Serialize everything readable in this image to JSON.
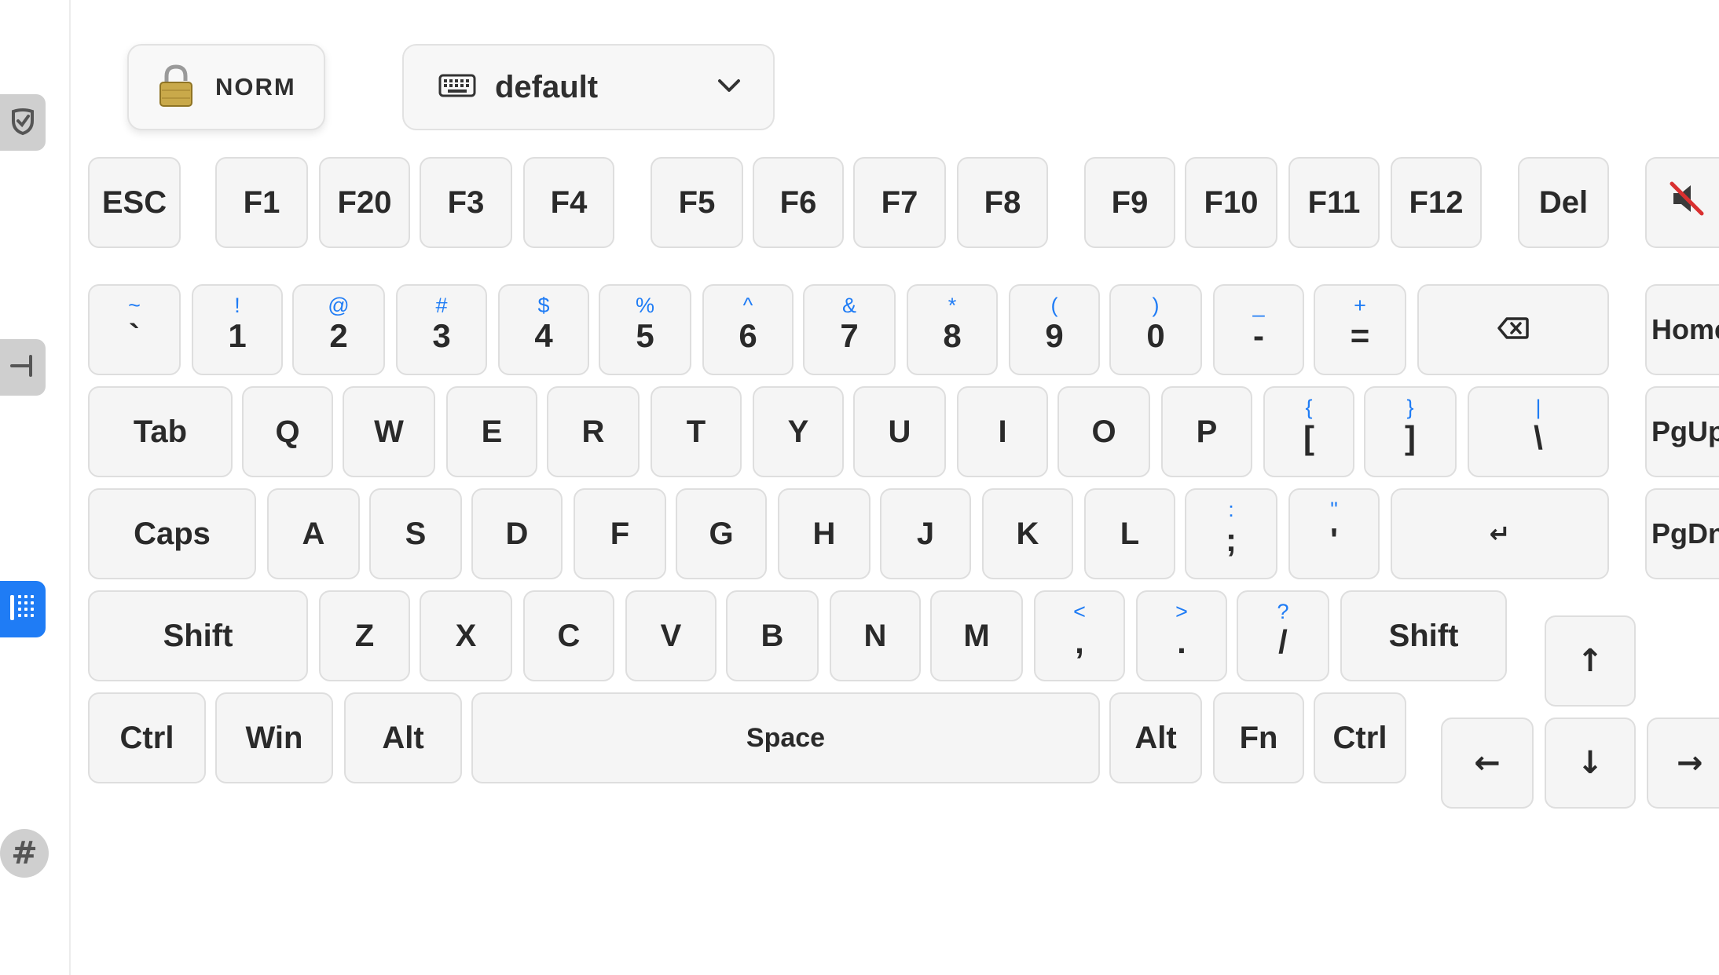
{
  "sidebar": {
    "items": [
      {
        "icon": "shield-check-icon"
      },
      {
        "icon": "bar-align-icon"
      },
      {
        "icon": "keyboard-grid-icon",
        "active": true
      },
      {
        "icon": "hash-icon",
        "glyph": "#"
      }
    ]
  },
  "mode_badge": {
    "icon": "padlock-icon",
    "label": "NORM"
  },
  "layout_select": {
    "icon": "keyboard-icon",
    "value": "default",
    "chevron": "chevron-down-icon"
  },
  "function_row": [
    "ESC",
    "F1",
    "F20",
    "F3",
    "F4",
    "F5",
    "F6",
    "F7",
    "F8",
    "F9",
    "F10",
    "F11",
    "F12",
    "Del"
  ],
  "mute_key": {
    "icon": "speaker-muted-icon"
  },
  "number_row": [
    {
      "shift": "~",
      "main": "`"
    },
    {
      "shift": "!",
      "main": "1"
    },
    {
      "shift": "@",
      "main": "2"
    },
    {
      "shift": "#",
      "main": "3"
    },
    {
      "shift": "$",
      "main": "4"
    },
    {
      "shift": "%",
      "main": "5"
    },
    {
      "shift": "^",
      "main": "6"
    },
    {
      "shift": "&",
      "main": "7"
    },
    {
      "shift": "*",
      "main": "8"
    },
    {
      "shift": "(",
      "main": "9"
    },
    {
      "shift": ")",
      "main": "0"
    },
    {
      "shift": "_",
      "main": "-"
    },
    {
      "shift": "+",
      "main": "="
    }
  ],
  "backspace_key": {
    "icon": "backspace-icon"
  },
  "tab_row": {
    "tab": "Tab",
    "letters": [
      "Q",
      "W",
      "E",
      "R",
      "T",
      "Y",
      "U",
      "I",
      "O",
      "P"
    ],
    "symbols": [
      {
        "shift": "{",
        "main": "["
      },
      {
        "shift": "}",
        "main": "]"
      },
      {
        "shift": "|",
        "main": "\\"
      }
    ]
  },
  "caps_row": {
    "caps": "Caps",
    "letters": [
      "A",
      "S",
      "D",
      "F",
      "G",
      "H",
      "J",
      "K",
      "L"
    ],
    "symbols": [
      {
        "shift": ":",
        "main": ";"
      },
      {
        "shift": "\"",
        "main": "'"
      }
    ],
    "enter_glyph": "↵"
  },
  "shift_row": {
    "left_shift": "Shift",
    "letters": [
      "Z",
      "X",
      "C",
      "V",
      "B",
      "N",
      "M"
    ],
    "symbols": [
      {
        "shift": "<",
        "main": ","
      },
      {
        "shift": ">",
        "main": "."
      },
      {
        "shift": "?",
        "main": "/"
      }
    ],
    "right_shift": "Shift"
  },
  "bottom_row": {
    "left": [
      "Ctrl",
      "Win",
      "Alt"
    ],
    "space": "Space",
    "right": [
      "Alt",
      "Fn",
      "Ctrl"
    ]
  },
  "nav_keys": [
    "Home",
    "PgUp",
    "PgDn"
  ],
  "arrow_keys": {
    "up": "↑",
    "left": "←",
    "down": "↓",
    "right": "→"
  },
  "colors": {
    "accent": "#1f7cf5",
    "key_bg": "#f5f5f5",
    "key_border": "#dedede",
    "sidebar_btn": "#cfcfcf"
  }
}
